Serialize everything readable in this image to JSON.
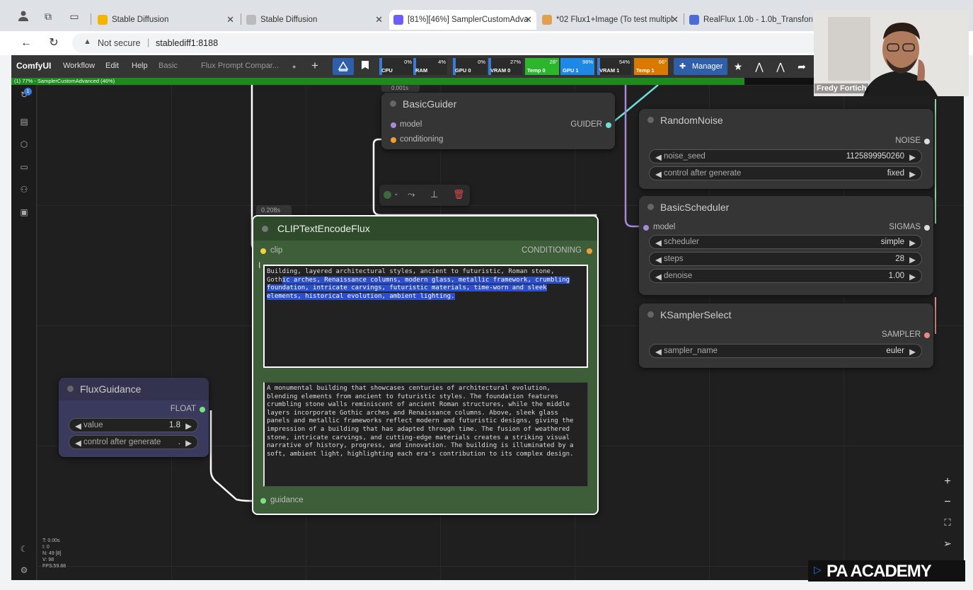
{
  "browser": {
    "tabs": [
      {
        "title": "Stable Diffusion",
        "fav": "#f4b400",
        "active": false
      },
      {
        "title": "Stable Diffusion",
        "fav": "#bbb",
        "active": false
      },
      {
        "title": "[81%][46%] SamplerCustomAdva",
        "fav": "#6d5dfc",
        "active": true
      },
      {
        "title": "*02 Flux1+Image (To test multipl",
        "fav": "#e0a050",
        "active": false
      },
      {
        "title": "RealFlux 1.0b - 1.0b_Transformer",
        "fav": "#4b6bd6",
        "active": false
      }
    ],
    "security": "Not secure",
    "url": "stablediff1:8188"
  },
  "menubar": {
    "logo": "ComfyUI",
    "items": [
      "Workflow",
      "Edit",
      "Help"
    ],
    "workflow_tabs": [
      "Basic",
      "Flux Prompt Compar...",
      "●"
    ],
    "manager": "Manager",
    "monitors": [
      {
        "label": "CPU",
        "pct": "0%",
        "color": "#3a7bd5"
      },
      {
        "label": "RAM",
        "pct": "4%",
        "color": "#3a7bd5"
      },
      {
        "label": "GPU 0",
        "pct": "0%",
        "color": "#3a7bd5"
      },
      {
        "label": "VRAM 0",
        "pct": "27%",
        "color": "#3a7bd5"
      },
      {
        "label": "Temp 0",
        "pct": "28°",
        "color": "#2db52d"
      },
      {
        "label": "GPU 1",
        "pct": "98%",
        "color": "#1e88e5"
      },
      {
        "label": "VRAM 1",
        "pct": "54%",
        "color": "#3a7bd5"
      },
      {
        "label": "Temp 1",
        "pct": "66°",
        "color": "#d97a00"
      }
    ]
  },
  "progress": {
    "label": "(1) 77% - SamplerCustomAdvanced (46%)",
    "percent": 77
  },
  "nodes": {
    "basic_guider": {
      "badge": "0.001s",
      "title": "BasicGuider",
      "in_model": "model",
      "in_conditioning": "conditioning",
      "out": "GUIDER"
    },
    "random_noise": {
      "title": "RandomNoise",
      "out": "NOISE",
      "w1_name": "noise_seed",
      "w1_val": "1125899950260",
      "w2_name": "control after generate",
      "w2_val": "fixed"
    },
    "basic_scheduler": {
      "title": "BasicScheduler",
      "in_model": "model",
      "out": "SIGMAS",
      "w1_name": "scheduler",
      "w1_val": "simple",
      "w2_name": "steps",
      "w2_val": "28",
      "w3_name": "denoise",
      "w3_val": "1.00"
    },
    "ksampler_select": {
      "title": "KSamplerSelect",
      "out": "SAMPLER",
      "w1_name": "sampler_name",
      "w1_val": "euler"
    },
    "clip_text": {
      "badge": "0.208s",
      "title": "CLIPTextEncodeFlux",
      "in_clip": "clip",
      "out": "CONDITIONING",
      "in_guidance": "guidance",
      "text1_plain": "Building, layered architectural styles, ancient to futuristic, Roman stone,\nGoth",
      "text1_selected": "ic arches, Renaissance columns, modern glass, metallic framework, crumbling\nfoundation, intricate carvings, futuristic materials, time-worn and sleek\nelements, historical evolution, ambient lighting.",
      "text2": "A monumental building that showcases centuries of architectural evolution,\nblending elements from ancient to futuristic styles. The foundation features\ncrumbling stone walls reminiscent of ancient Roman structures, while the middle\nlayers incorporate Gothic arches and Renaissance columns. Above, sleek glass\npanels and metallic frameworks reflect modern and futuristic designs, giving the\nimpression of a building that has adapted through time. The fusion of weathered\nstone, intricate carvings, and cutting-edge materials creates a striking visual\nnarrative of history, progress, and innovation. The building is illuminated by a\nsoft, ambient light, highlighting each era's contribution to its complex design."
    },
    "flux_guidance": {
      "title": "FluxGuidance",
      "out": "FLOAT",
      "w1_name": "value",
      "w1_val": "1.8",
      "w2_name": "control after generate",
      "w2_val": "."
    }
  },
  "stats": "T: 0.00s\nI: 0\nN: 49 [8]\nV: 98\nFPS:59.88",
  "webcam_name": "Fredy Fortich",
  "brand": "PA ACADEMY"
}
